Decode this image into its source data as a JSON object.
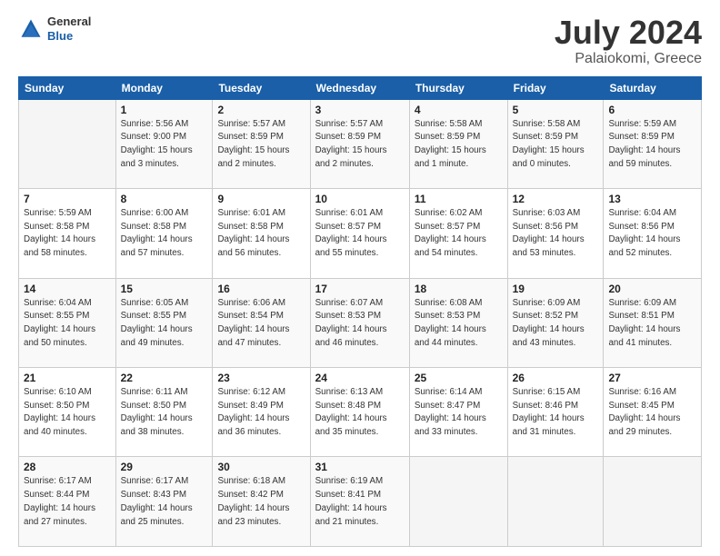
{
  "header": {
    "logo_general": "General",
    "logo_blue": "Blue",
    "title": "July 2024",
    "subtitle": "Palaiokomi, Greece"
  },
  "calendar": {
    "columns": [
      "Sunday",
      "Monday",
      "Tuesday",
      "Wednesday",
      "Thursday",
      "Friday",
      "Saturday"
    ],
    "weeks": [
      [
        {
          "day": "",
          "info": ""
        },
        {
          "day": "1",
          "info": "Sunrise: 5:56 AM\nSunset: 9:00 PM\nDaylight: 15 hours\nand 3 minutes."
        },
        {
          "day": "2",
          "info": "Sunrise: 5:57 AM\nSunset: 8:59 PM\nDaylight: 15 hours\nand 2 minutes."
        },
        {
          "day": "3",
          "info": "Sunrise: 5:57 AM\nSunset: 8:59 PM\nDaylight: 15 hours\nand 2 minutes."
        },
        {
          "day": "4",
          "info": "Sunrise: 5:58 AM\nSunset: 8:59 PM\nDaylight: 15 hours\nand 1 minute."
        },
        {
          "day": "5",
          "info": "Sunrise: 5:58 AM\nSunset: 8:59 PM\nDaylight: 15 hours\nand 0 minutes."
        },
        {
          "day": "6",
          "info": "Sunrise: 5:59 AM\nSunset: 8:59 PM\nDaylight: 14 hours\nand 59 minutes."
        }
      ],
      [
        {
          "day": "7",
          "info": "Sunrise: 5:59 AM\nSunset: 8:58 PM\nDaylight: 14 hours\nand 58 minutes."
        },
        {
          "day": "8",
          "info": "Sunrise: 6:00 AM\nSunset: 8:58 PM\nDaylight: 14 hours\nand 57 minutes."
        },
        {
          "day": "9",
          "info": "Sunrise: 6:01 AM\nSunset: 8:58 PM\nDaylight: 14 hours\nand 56 minutes."
        },
        {
          "day": "10",
          "info": "Sunrise: 6:01 AM\nSunset: 8:57 PM\nDaylight: 14 hours\nand 55 minutes."
        },
        {
          "day": "11",
          "info": "Sunrise: 6:02 AM\nSunset: 8:57 PM\nDaylight: 14 hours\nand 54 minutes."
        },
        {
          "day": "12",
          "info": "Sunrise: 6:03 AM\nSunset: 8:56 PM\nDaylight: 14 hours\nand 53 minutes."
        },
        {
          "day": "13",
          "info": "Sunrise: 6:04 AM\nSunset: 8:56 PM\nDaylight: 14 hours\nand 52 minutes."
        }
      ],
      [
        {
          "day": "14",
          "info": "Sunrise: 6:04 AM\nSunset: 8:55 PM\nDaylight: 14 hours\nand 50 minutes."
        },
        {
          "day": "15",
          "info": "Sunrise: 6:05 AM\nSunset: 8:55 PM\nDaylight: 14 hours\nand 49 minutes."
        },
        {
          "day": "16",
          "info": "Sunrise: 6:06 AM\nSunset: 8:54 PM\nDaylight: 14 hours\nand 47 minutes."
        },
        {
          "day": "17",
          "info": "Sunrise: 6:07 AM\nSunset: 8:53 PM\nDaylight: 14 hours\nand 46 minutes."
        },
        {
          "day": "18",
          "info": "Sunrise: 6:08 AM\nSunset: 8:53 PM\nDaylight: 14 hours\nand 44 minutes."
        },
        {
          "day": "19",
          "info": "Sunrise: 6:09 AM\nSunset: 8:52 PM\nDaylight: 14 hours\nand 43 minutes."
        },
        {
          "day": "20",
          "info": "Sunrise: 6:09 AM\nSunset: 8:51 PM\nDaylight: 14 hours\nand 41 minutes."
        }
      ],
      [
        {
          "day": "21",
          "info": "Sunrise: 6:10 AM\nSunset: 8:50 PM\nDaylight: 14 hours\nand 40 minutes."
        },
        {
          "day": "22",
          "info": "Sunrise: 6:11 AM\nSunset: 8:50 PM\nDaylight: 14 hours\nand 38 minutes."
        },
        {
          "day": "23",
          "info": "Sunrise: 6:12 AM\nSunset: 8:49 PM\nDaylight: 14 hours\nand 36 minutes."
        },
        {
          "day": "24",
          "info": "Sunrise: 6:13 AM\nSunset: 8:48 PM\nDaylight: 14 hours\nand 35 minutes."
        },
        {
          "day": "25",
          "info": "Sunrise: 6:14 AM\nSunset: 8:47 PM\nDaylight: 14 hours\nand 33 minutes."
        },
        {
          "day": "26",
          "info": "Sunrise: 6:15 AM\nSunset: 8:46 PM\nDaylight: 14 hours\nand 31 minutes."
        },
        {
          "day": "27",
          "info": "Sunrise: 6:16 AM\nSunset: 8:45 PM\nDaylight: 14 hours\nand 29 minutes."
        }
      ],
      [
        {
          "day": "28",
          "info": "Sunrise: 6:17 AM\nSunset: 8:44 PM\nDaylight: 14 hours\nand 27 minutes."
        },
        {
          "day": "29",
          "info": "Sunrise: 6:17 AM\nSunset: 8:43 PM\nDaylight: 14 hours\nand 25 minutes."
        },
        {
          "day": "30",
          "info": "Sunrise: 6:18 AM\nSunset: 8:42 PM\nDaylight: 14 hours\nand 23 minutes."
        },
        {
          "day": "31",
          "info": "Sunrise: 6:19 AM\nSunset: 8:41 PM\nDaylight: 14 hours\nand 21 minutes."
        },
        {
          "day": "",
          "info": ""
        },
        {
          "day": "",
          "info": ""
        },
        {
          "day": "",
          "info": ""
        }
      ]
    ]
  }
}
